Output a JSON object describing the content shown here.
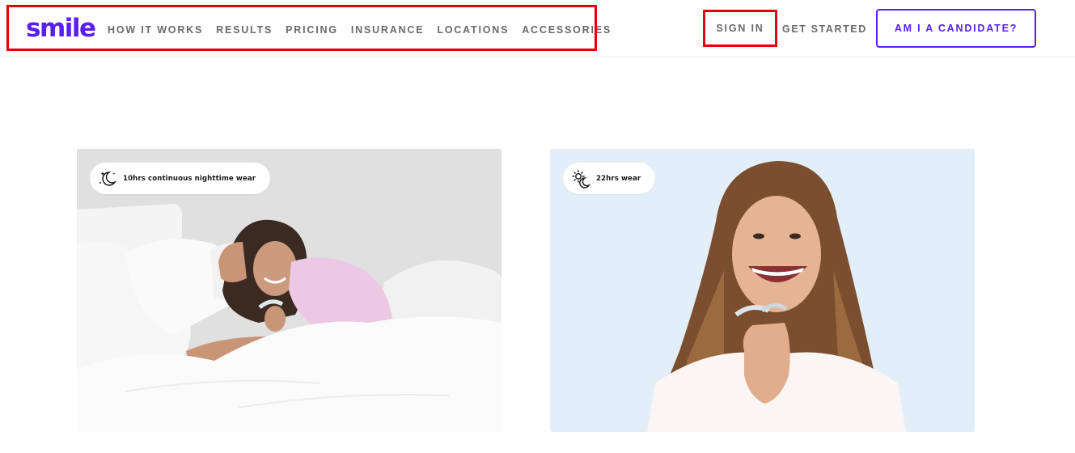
{
  "header": {
    "logo": "smile",
    "nav": [
      {
        "label": "HOW IT WORKS"
      },
      {
        "label": "RESULTS"
      },
      {
        "label": "PRICING"
      },
      {
        "label": "INSURANCE"
      },
      {
        "label": "LOCATIONS"
      },
      {
        "label": "ACCESSORIES"
      }
    ],
    "sign_in": "SIGN IN",
    "get_started": "GET STARTED",
    "candidate_button": "AM I A CANDIDATE?"
  },
  "cards": [
    {
      "badge": "10hrs continuous nighttime wear",
      "icon": "moon-stars-icon"
    },
    {
      "badge": "22hrs wear",
      "icon": "sun-moon-icon"
    }
  ],
  "colors": {
    "brand": "#5a1ff0",
    "nav_text": "#6a6a6a",
    "highlight": "#e3000b",
    "card_left_bg": "#e2e2e2",
    "card_right_bg": "#e4f0f8"
  }
}
